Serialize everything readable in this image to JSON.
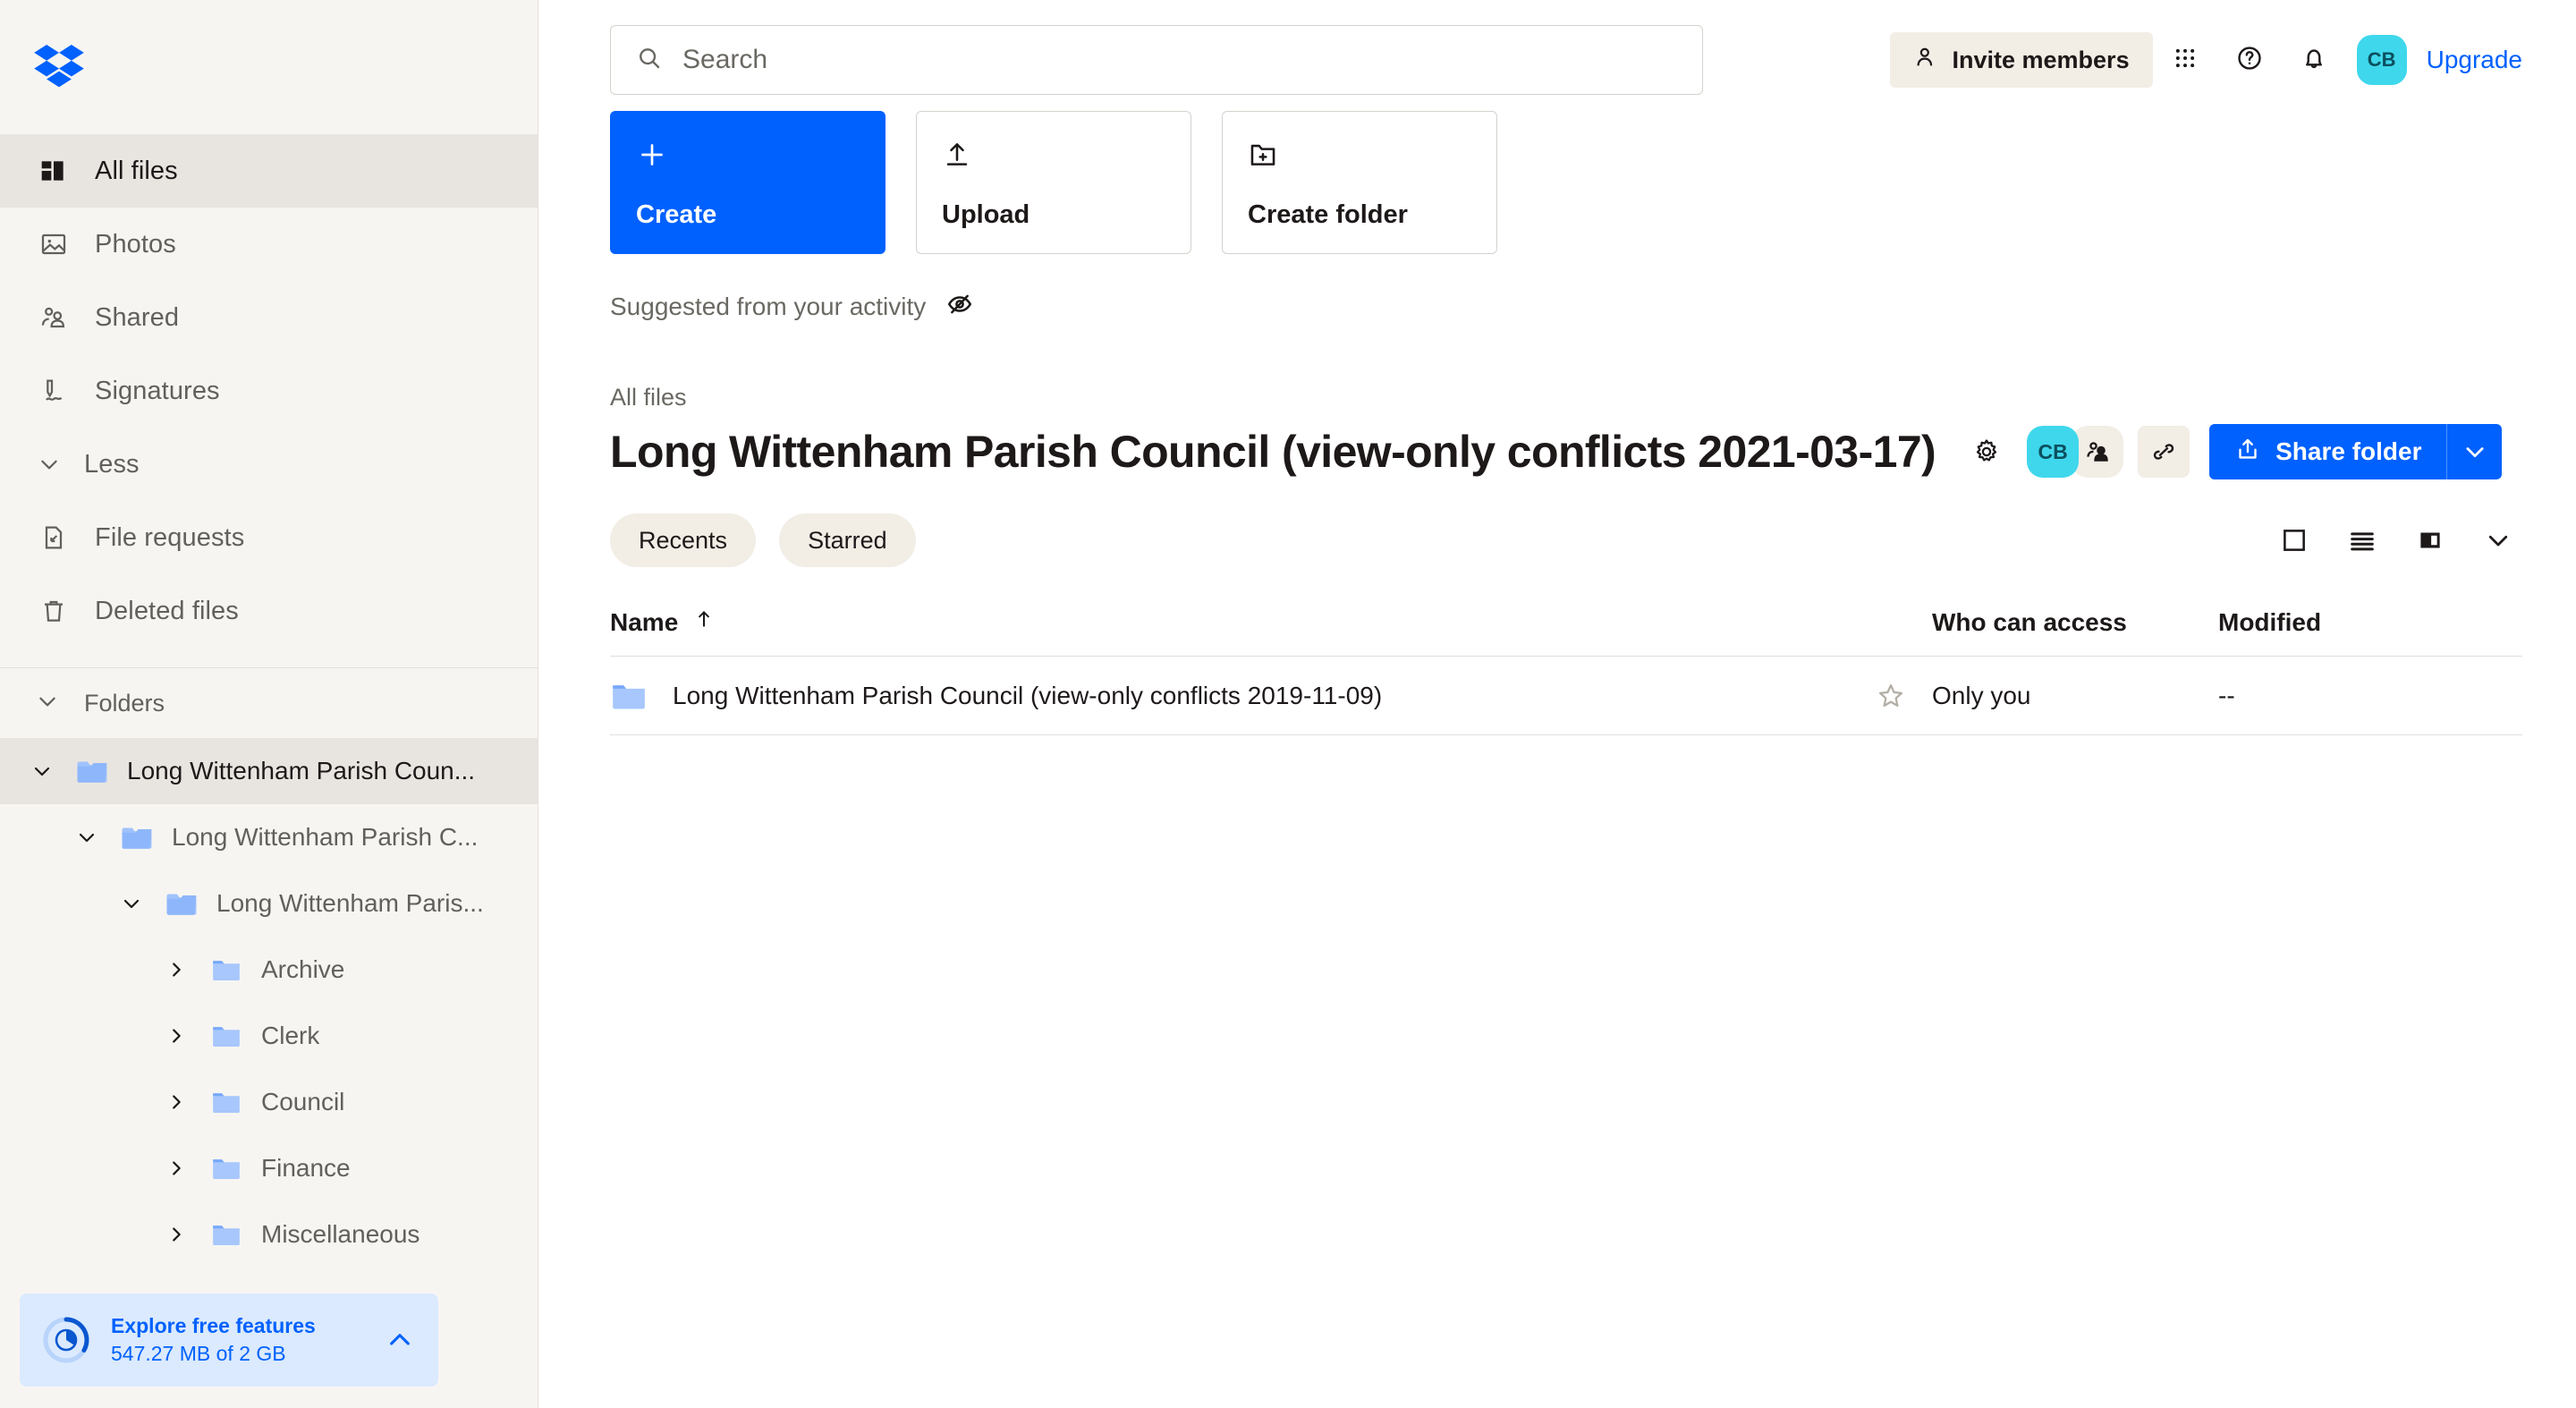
{
  "brand": {
    "logo_icon": "dropbox-logo",
    "primary_color": "#0061fe",
    "sidebar_bg": "#f7f5f2",
    "avatar_color": "#3fd7ec",
    "pill_bg": "#f2ede5"
  },
  "sidebar": {
    "nav": [
      {
        "label": "All files",
        "icon": "all-files-icon",
        "active": true
      },
      {
        "label": "Photos",
        "icon": "photos-icon",
        "active": false
      },
      {
        "label": "Shared",
        "icon": "shared-icon",
        "active": false
      },
      {
        "label": "Signatures",
        "icon": "signatures-icon",
        "active": false
      }
    ],
    "less": {
      "label": "Less",
      "icon": "chevron-down-icon"
    },
    "secondary": [
      {
        "label": "File requests",
        "icon": "file-request-icon"
      },
      {
        "label": "Deleted files",
        "icon": "trash-icon"
      }
    ],
    "folders_section": {
      "label": "Folders",
      "icon": "chevron-down-icon"
    },
    "tree": [
      {
        "label": "Long Wittenham Parish Coun...",
        "depth": 0,
        "expanded": true,
        "selected": true
      },
      {
        "label": "Long Wittenham Parish C...",
        "depth": 1,
        "expanded": true,
        "selected": false
      },
      {
        "label": "Long Wittenham Paris...",
        "depth": 2,
        "expanded": true,
        "selected": false
      },
      {
        "label": "Archive",
        "depth": 3,
        "expanded": false,
        "selected": false
      },
      {
        "label": "Clerk",
        "depth": 3,
        "expanded": false,
        "selected": false
      },
      {
        "label": "Council",
        "depth": 3,
        "expanded": false,
        "selected": false
      },
      {
        "label": "Finance",
        "depth": 3,
        "expanded": false,
        "selected": false
      },
      {
        "label": "Miscellaneous",
        "depth": 3,
        "expanded": false,
        "selected": false
      }
    ],
    "storage": {
      "title": "Explore free features",
      "subtitle": "547.27 MB of 2 GB",
      "collapse_icon": "chevron-up-icon",
      "ring_icon": "storage-pie-icon"
    }
  },
  "header": {
    "search": {
      "placeholder": "Search",
      "value": "",
      "icon": "search-icon"
    },
    "invite_members": {
      "label": "Invite members",
      "icon": "person-add-icon"
    },
    "apps_icon": "grid-apps-icon",
    "help_icon": "help-circle-icon",
    "notifications_icon": "bell-icon",
    "avatar": {
      "initials": "CB"
    },
    "upgrade": {
      "label": "Upgrade"
    }
  },
  "actions": {
    "tiles": [
      {
        "label": "Create",
        "icon": "plus-icon",
        "primary": true
      },
      {
        "label": "Upload",
        "icon": "upload-icon",
        "primary": false
      },
      {
        "label": "Create folder",
        "icon": "folder-plus-icon",
        "primary": false
      }
    ],
    "suggested": {
      "label": "Suggested from your activity",
      "icon": "eye-off-icon"
    }
  },
  "content": {
    "breadcrumb": "All files",
    "title": "Long Wittenham Parish Council (view-only conflicts 2021-03-17)",
    "gear_icon": "gear-icon",
    "facepile_avatar": "CB",
    "facepile_people_icon": "people-icon",
    "copy_link_icon": "link-icon",
    "share": {
      "label": "Share folder",
      "icon": "share-upload-icon",
      "caret_icon": "chevron-down-icon"
    },
    "filters": [
      {
        "label": "Recents"
      },
      {
        "label": "Starred"
      }
    ],
    "view_controls": [
      {
        "icon": "grid-view-icon"
      },
      {
        "icon": "list-view-icon"
      },
      {
        "icon": "split-pane-icon"
      },
      {
        "icon": "chevron-down-icon"
      }
    ],
    "table": {
      "columns": {
        "name": "Name",
        "sort_icon": "arrow-up-icon",
        "access": "Who can access",
        "modified": "Modified"
      },
      "rows": [
        {
          "icon": "folder-icon",
          "name": "Long Wittenham Parish Council (view-only conflicts 2019-11-09)",
          "star_icon": "star-outline-icon",
          "access": "Only you",
          "modified": "--"
        }
      ]
    }
  }
}
